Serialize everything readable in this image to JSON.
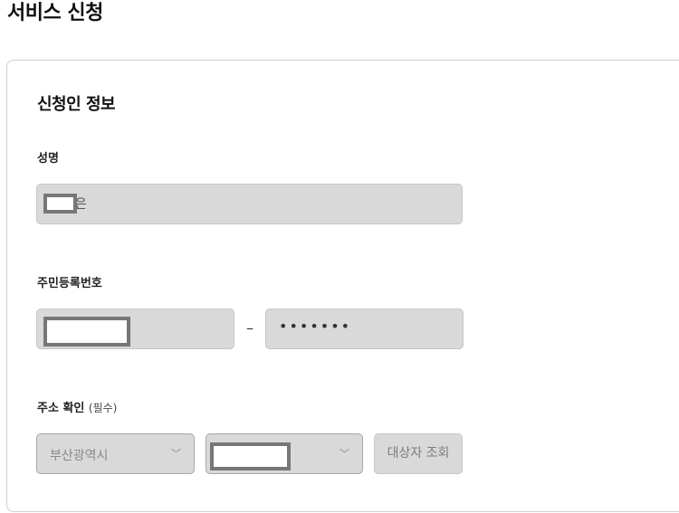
{
  "page": {
    "title": "서비스 신청"
  },
  "section": {
    "title": "신청인 정보"
  },
  "name_field": {
    "label": "성명",
    "value_tail": "은"
  },
  "rrn_field": {
    "label": "주민등록번호",
    "separator": "–",
    "back_masked": "•••••••"
  },
  "address_field": {
    "label": "주소 확인",
    "sublabel": "(필수)",
    "city_value": "부산광역시",
    "chevron": "﹀",
    "lookup_label": "대상자 조회"
  },
  "icons": {
    "chevron": "chevron-down-icon"
  },
  "colors": {
    "input_bg": "#d9d9d9",
    "redaction": "#777777"
  }
}
